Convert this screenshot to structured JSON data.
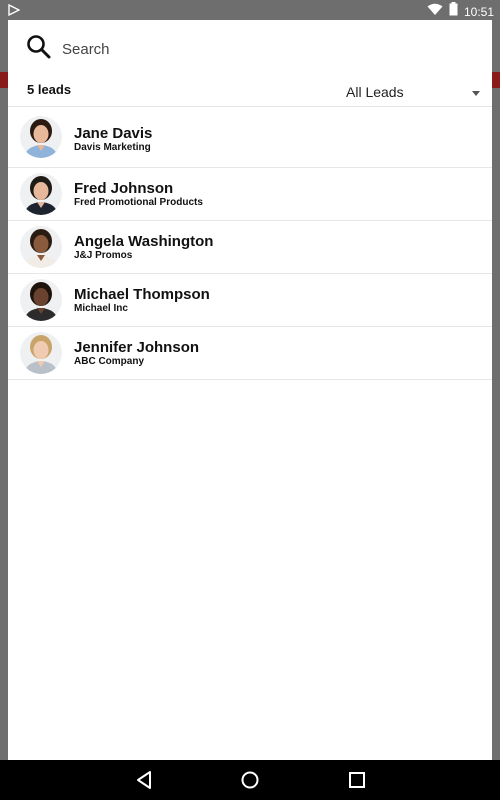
{
  "status_bar": {
    "time": "10:51"
  },
  "search": {
    "placeholder": "Search"
  },
  "filter": {
    "count_label": "5 leads",
    "selected": "All Leads"
  },
  "leads": [
    {
      "name": "Jane Davis",
      "company": "Davis Marketing",
      "skin": "#e8b89a",
      "hair": "#2a1a12",
      "shirt": "#8fb3d9"
    },
    {
      "name": "Fred Johnson",
      "company": "Fred Promotional Products",
      "skin": "#e7b79b",
      "hair": "#1f1a16",
      "shirt": "#1d2430"
    },
    {
      "name": "Angela Washington",
      "company": "J&J Promos",
      "skin": "#8a5a3c",
      "hair": "#2b1c12",
      "shirt": "#f1ede6"
    },
    {
      "name": "Michael Thompson",
      "company": "Michael Inc",
      "skin": "#6a4330",
      "hair": "#1d130d",
      "shirt": "#2c2c2c"
    },
    {
      "name": "Jennifer Johnson",
      "company": "ABC Company",
      "skin": "#f0cbb1",
      "hair": "#c9a46a",
      "shirt": "#b9c0c7"
    }
  ]
}
